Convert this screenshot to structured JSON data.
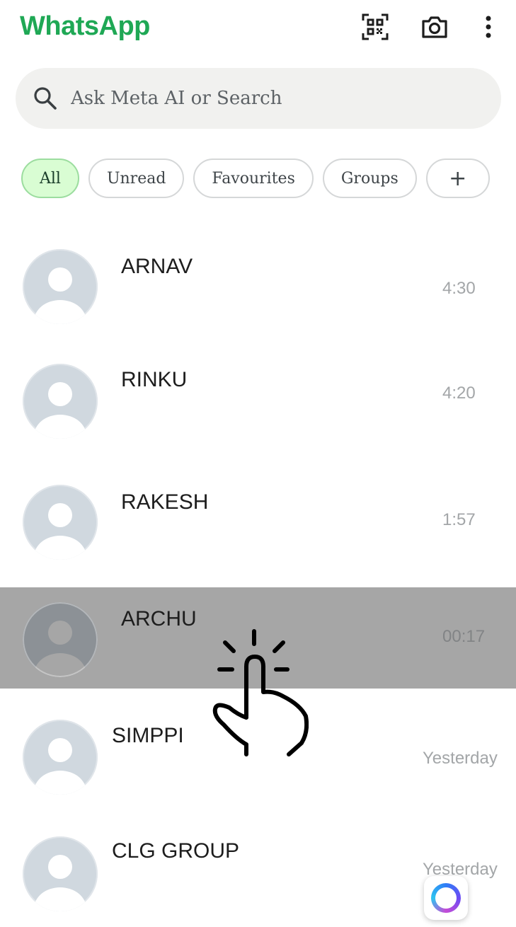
{
  "header": {
    "title": "WhatsApp",
    "brand_color": "#1fa855",
    "icons": [
      "qr-code-icon",
      "camera-icon",
      "more-vert-icon"
    ]
  },
  "search": {
    "placeholder": "Ask Meta AI or Search"
  },
  "filters": [
    {
      "label": "All",
      "active": true
    },
    {
      "label": "Unread",
      "active": false
    },
    {
      "label": "Favourites",
      "active": false
    },
    {
      "label": "Groups",
      "active": false
    },
    {
      "label": "+",
      "active": false
    }
  ],
  "chats": [
    {
      "name": "ARNAV",
      "time": "4:30"
    },
    {
      "name": "RINKU",
      "time": "4:20"
    },
    {
      "name": "RAKESH",
      "time": "1:57"
    },
    {
      "name": "ARCHU",
      "time": "00:17",
      "selected": true
    },
    {
      "name": "SIMPPI",
      "time": "Yesterday"
    },
    {
      "name": "CLG GROUP",
      "time": "Yesterday"
    }
  ],
  "overlay": {
    "gesture_icon": "tap-hand-icon"
  },
  "fab": {
    "icon": "meta-ai-icon"
  }
}
